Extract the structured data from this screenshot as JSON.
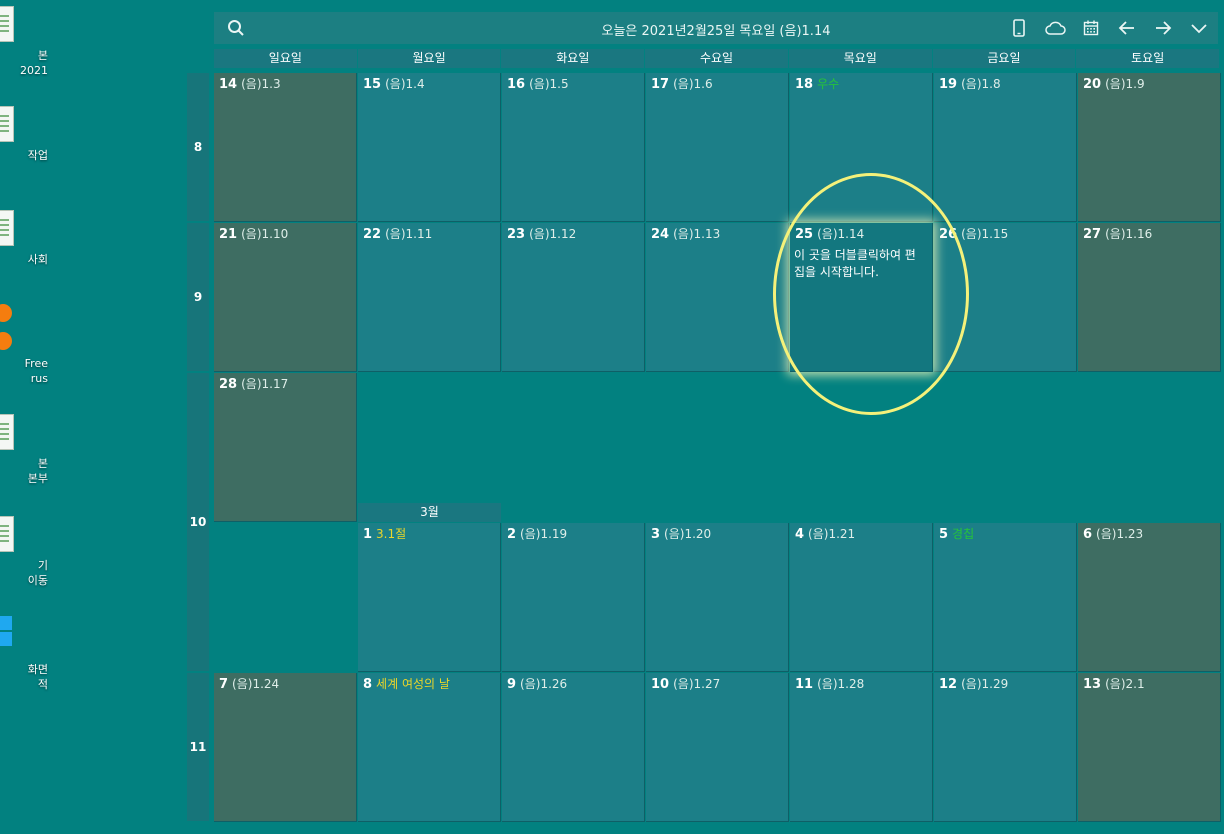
{
  "desktop": {
    "icons": [
      {
        "name": "doc-icon",
        "label1": "본",
        "label2": "2021"
      },
      {
        "name": "doc-icon",
        "label1": "작업",
        "label2": ""
      },
      {
        "name": "doc-icon",
        "label1": "사회",
        "label2": ""
      },
      {
        "name": "app-icon",
        "label1": "Free",
        "label2": "rus"
      },
      {
        "name": "doc-icon",
        "label1": "본",
        "label2": "본부"
      },
      {
        "name": "doc-icon",
        "label1": "기",
        "label2": "이동"
      },
      {
        "name": "windows-icon",
        "label1": "화면",
        "label2": "적"
      }
    ]
  },
  "header": {
    "title": "오늘은 2021년2월25일 목요일 (음)1.14",
    "icons": [
      "search-icon",
      "phone-icon",
      "cloud-icon",
      "calendar-icon",
      "arrow-left-icon",
      "arrow-right-icon",
      "chevron-down-icon"
    ]
  },
  "weekdays": [
    "일요일",
    "월요일",
    "화요일",
    "수요일",
    "목요일",
    "금요일",
    "토요일"
  ],
  "weeks": [
    "8",
    "9",
    "10",
    "11"
  ],
  "month_label": "3월",
  "days": [
    {
      "day": "14",
      "lunar": "(음)1.3"
    },
    {
      "day": "15",
      "lunar": "(음)1.4"
    },
    {
      "day": "16",
      "lunar": "(음)1.5"
    },
    {
      "day": "17",
      "lunar": "(음)1.6"
    },
    {
      "day": "18",
      "lunar": "우수"
    },
    {
      "day": "19",
      "lunar": "(음)1.8"
    },
    {
      "day": "20",
      "lunar": "(음)1.9"
    },
    {
      "day": "21",
      "lunar": "(음)1.10"
    },
    {
      "day": "22",
      "lunar": "(음)1.11"
    },
    {
      "day": "23",
      "lunar": "(음)1.12"
    },
    {
      "day": "24",
      "lunar": "(음)1.13"
    },
    {
      "day": "25",
      "lunar": "(음)1.14",
      "memo": "이 곳을 더블클릭하여 편집을 시작합니다."
    },
    {
      "day": "26",
      "lunar": "(음)1.15"
    },
    {
      "day": "27",
      "lunar": "(음)1.16"
    },
    {
      "day": "28",
      "lunar": "(음)1.17"
    },
    {
      "day": "1",
      "lunar": "3.1절"
    },
    {
      "day": "2",
      "lunar": "(음)1.19"
    },
    {
      "day": "3",
      "lunar": "(음)1.20"
    },
    {
      "day": "4",
      "lunar": "(음)1.21"
    },
    {
      "day": "5",
      "lunar": "경칩"
    },
    {
      "day": "6",
      "lunar": "(음)1.23"
    },
    {
      "day": "7",
      "lunar": "(음)1.24"
    },
    {
      "day": "8",
      "lunar": "세계 여성의 날"
    },
    {
      "day": "9",
      "lunar": "(음)1.26"
    },
    {
      "day": "10",
      "lunar": "(음)1.27"
    },
    {
      "day": "11",
      "lunar": "(음)1.28"
    },
    {
      "day": "12",
      "lunar": "(음)1.29"
    },
    {
      "day": "13",
      "lunar": "(음)2.1"
    }
  ],
  "colors": {
    "background": "#028180",
    "weekday_cell": "#1c7f88",
    "weekend_cell": "#3e6d62",
    "solar_term": "#26c43a",
    "holiday": "#e9d52a",
    "highlight": "#f4f17a"
  }
}
